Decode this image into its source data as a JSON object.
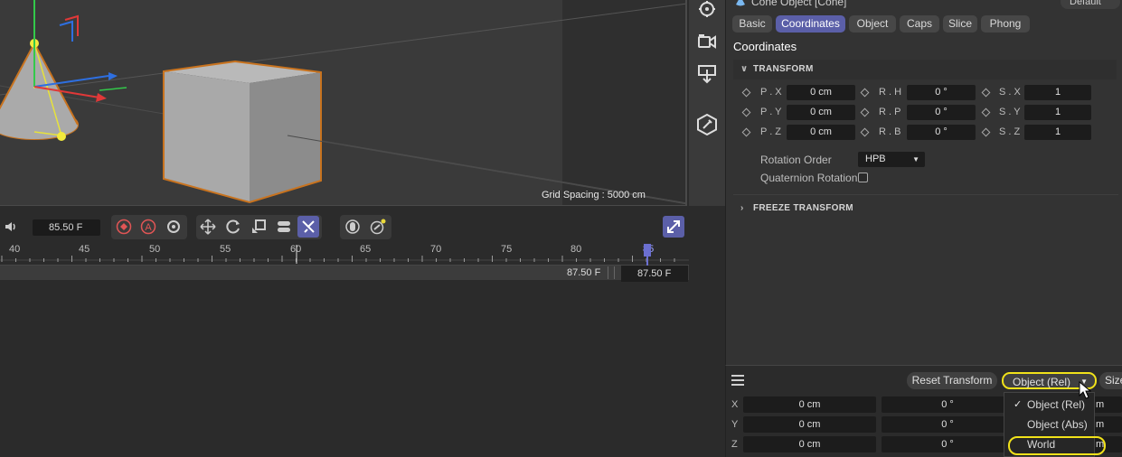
{
  "attributes": {
    "object_title": "Cone Object [Cone]",
    "mode": "Default",
    "tabs": [
      "Basic",
      "Coordinates",
      "Object",
      "Caps",
      "Slice",
      "Phong"
    ],
    "active_tab": "Coordinates",
    "section_title": "Coordinates",
    "transform_group": "TRANSFORM",
    "freeze_group": "FREEZE TRANSFORM",
    "position": {
      "x_label": "P . X",
      "y_label": "P . Y",
      "z_label": "P . Z",
      "x": "0 cm",
      "y": "0 cm",
      "z": "0 cm"
    },
    "rotation": {
      "h_label": "R . H",
      "p_label": "R . P",
      "b_label": "R . B",
      "h": "0 °",
      "p": "0 °",
      "b": "0 °"
    },
    "scale": {
      "x_label": "S . X",
      "y_label": "S . Y",
      "z_label": "S . Z",
      "x": "1",
      "y": "1",
      "z": "1"
    },
    "rotation_order_label": "Rotation Order",
    "rotation_order": "HPB",
    "quaternion_label": "Quaternion Rotation",
    "quaternion_checked": false
  },
  "viewport": {
    "grid_spacing": "Grid Spacing : 5000 cm"
  },
  "timeline": {
    "current_frame": "85.50 F",
    "ruler_labels": [
      "40",
      "45",
      "50",
      "55",
      "60",
      "65",
      "70",
      "75",
      "80",
      "85"
    ],
    "range_end": "87.50 F",
    "end_frame": "87.50 F",
    "accent_color": "#5b5fa8"
  },
  "coordinate_manager": {
    "reset_label": "Reset Transform",
    "mode_selected": "Object (Rel)",
    "size_label": "Size",
    "axes": [
      "X",
      "Y",
      "Z"
    ],
    "position_values": [
      "0 cm",
      "0 cm",
      "0 cm"
    ],
    "rotation_values": [
      "0 °",
      "0 °",
      "0 °"
    ],
    "size_values_partial": [
      "m",
      "m",
      "m"
    ],
    "dropdown_options": [
      "Object (Rel)",
      "Object (Abs)",
      "World"
    ],
    "highlight_color": "#f1e21a"
  }
}
